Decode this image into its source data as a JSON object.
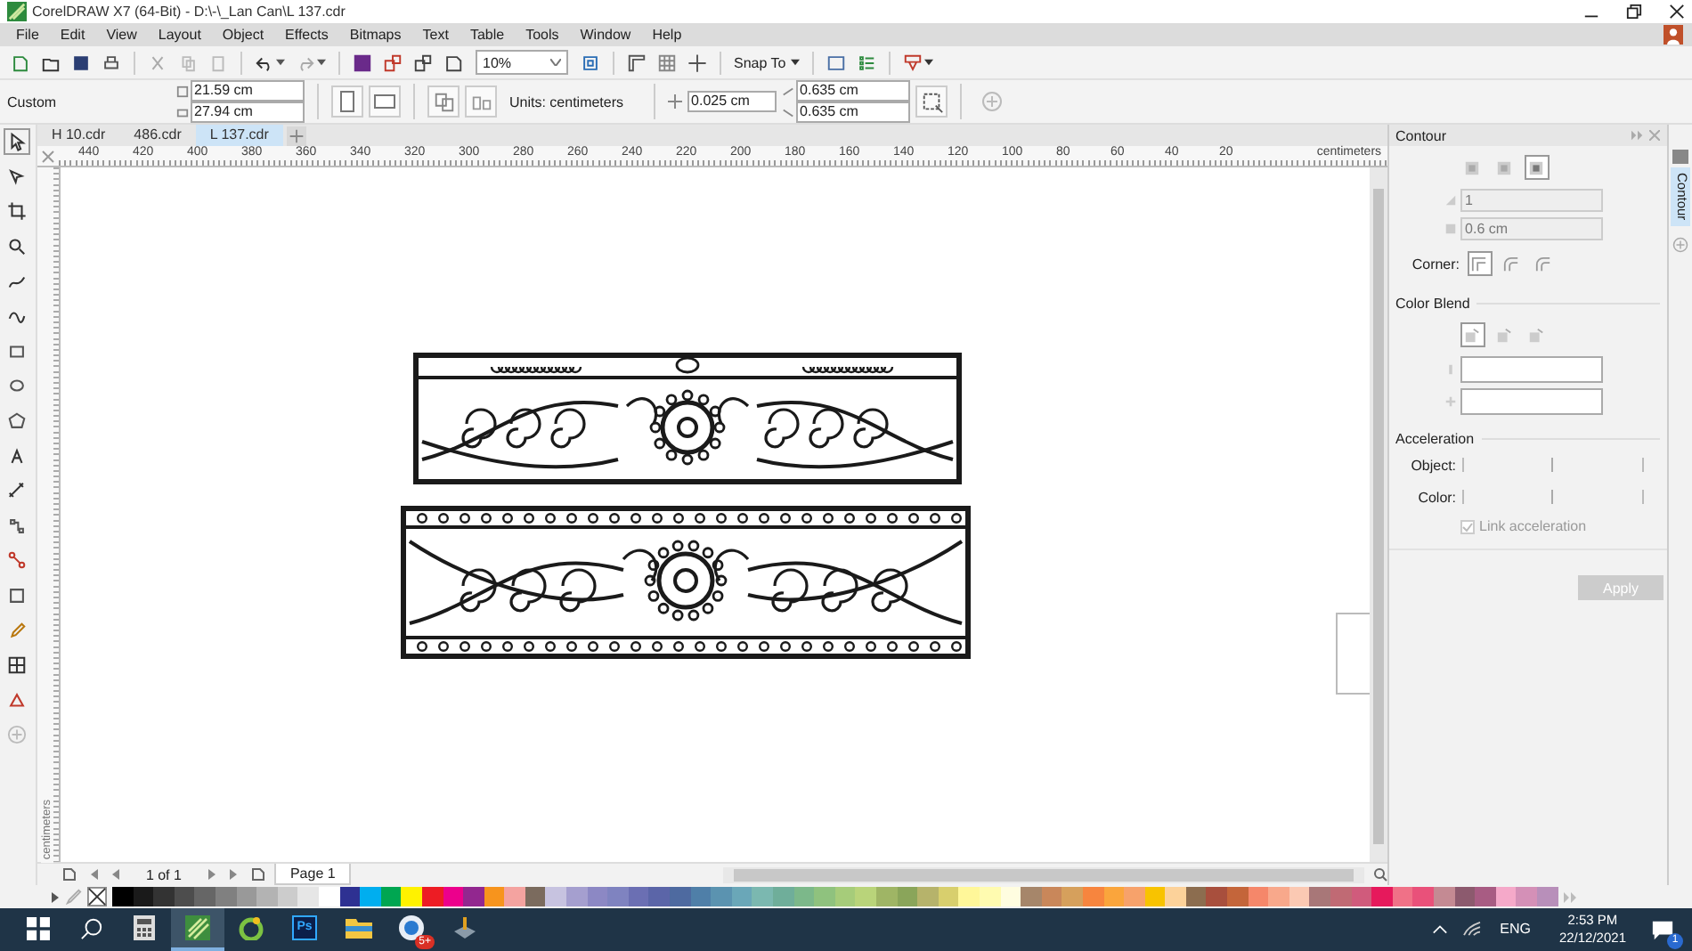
{
  "window": {
    "title": "CorelDRAW X7 (64-Bit) - D:\\-\\_Lan Can\\L 137.cdr"
  },
  "menu": [
    "File",
    "Edit",
    "View",
    "Layout",
    "Object",
    "Effects",
    "Bitmaps",
    "Text",
    "Table",
    "Tools",
    "Window",
    "Help"
  ],
  "toolbar": {
    "zoom": "10%",
    "snap": "Snap To"
  },
  "property_bar": {
    "preset": "Custom",
    "width": "21.59 cm",
    "height": "27.94 cm",
    "units": "Units: centimeters",
    "nudge": "0.025 cm",
    "duplicate_x": "0.635 cm",
    "duplicate_y": "0.635 cm"
  },
  "document_tabs": [
    {
      "label": "H 10.cdr",
      "selected": false
    },
    {
      "label": "486.cdr",
      "selected": false
    },
    {
      "label": "L 137.cdr",
      "selected": true
    }
  ],
  "ruler": {
    "labels": [
      "440",
      "420",
      "400",
      "380",
      "360",
      "340",
      "320",
      "300",
      "280",
      "260",
      "240",
      "220",
      "200",
      "180",
      "160",
      "140",
      "120",
      "100",
      "80",
      "60",
      "40",
      "20"
    ],
    "unit": "centimeters",
    "vertical_unit": "centimeters"
  },
  "docker": {
    "title": "Contour",
    "modes": [
      {
        "selected": false
      },
      {
        "selected": false
      },
      {
        "selected": true
      }
    ],
    "steps": {
      "value": "1",
      "disabled": true
    },
    "offset": {
      "value": "0.6 cm",
      "disabled": true
    },
    "corner_label": "Corner:",
    "corners": [
      {
        "selected": true
      },
      {
        "selected": false
      },
      {
        "selected": false
      }
    ],
    "color_blend_title": "Color Blend",
    "blends": [
      {
        "selected": true
      },
      {
        "selected": false
      },
      {
        "selected": false
      }
    ],
    "acceleration_title": "Acceleration",
    "object_acceleration": {
      "label": "Object:",
      "level": 0.5
    },
    "color_acceleration": {
      "label": "Color:",
      "level": 0.5
    },
    "link_acceleration": {
      "label": "Link acceleration",
      "checked": true,
      "disabled": true
    },
    "apply": {
      "label": "Apply",
      "disabled": true
    }
  },
  "side_tabs": [
    {
      "label": "Contour",
      "selected": true
    }
  ],
  "page_nav": {
    "counter": "1 of 1",
    "pages": [
      {
        "label": "Page 1",
        "selected": true
      }
    ]
  },
  "palette": [
    {
      "color": "#000000"
    },
    {
      "color": "#1a1a1a"
    },
    {
      "color": "#333333"
    },
    {
      "color": "#4d4d4d"
    },
    {
      "color": "#666666"
    },
    {
      "color": "#808080"
    },
    {
      "color": "#999999"
    },
    {
      "color": "#b3b3b3"
    },
    {
      "color": "#cccccc"
    },
    {
      "color": "#e6e6e6"
    },
    {
      "color": "#ffffff"
    },
    {
      "color": "#2e3192"
    },
    {
      "color": "#00aeef"
    },
    {
      "color": "#00a651"
    },
    {
      "color": "#fff200"
    },
    {
      "color": "#ed1c24"
    },
    {
      "color": "#ec008c"
    },
    {
      "color": "#92278f"
    },
    {
      "color": "#f7941d"
    },
    {
      "color": "#f4a3a0"
    },
    {
      "color": "#7b6b5e"
    },
    {
      "color": "#c7c3e0"
    },
    {
      "color": "#a59fcf"
    },
    {
      "color": "#8c88c4"
    },
    {
      "color": "#7f83c0"
    },
    {
      "color": "#6b6fb3"
    },
    {
      "color": "#5b65a8"
    },
    {
      "color": "#4e6aa0"
    },
    {
      "color": "#4f7fa8"
    },
    {
      "color": "#5b93b0"
    },
    {
      "color": "#6aa7b8"
    },
    {
      "color": "#7bb8b0"
    },
    {
      "color": "#6fae9a"
    },
    {
      "color": "#7cb88a"
    },
    {
      "color": "#8fc27e"
    },
    {
      "color": "#a6cc7a"
    },
    {
      "color": "#b9d47a"
    },
    {
      "color": "#9fb565"
    },
    {
      "color": "#8aa55a"
    },
    {
      "color": "#b6b36b"
    },
    {
      "color": "#d8cf6d"
    },
    {
      "color": "#fff799"
    },
    {
      "color": "#fffbb0"
    },
    {
      "color": "#fffde0"
    },
    {
      "color": "#a6866a"
    },
    {
      "color": "#c9875a"
    },
    {
      "color": "#d6a05c"
    },
    {
      "color": "#f7853e"
    },
    {
      "color": "#faa53c"
    },
    {
      "color": "#f7a26b"
    },
    {
      "color": "#f8c300"
    },
    {
      "color": "#fcd29a"
    },
    {
      "color": "#8c6d4f"
    },
    {
      "color": "#a84f3d"
    },
    {
      "color": "#c4653a"
    },
    {
      "color": "#f5876a"
    },
    {
      "color": "#f8a88b"
    },
    {
      "color": "#fbc9b3"
    },
    {
      "color": "#a87778"
    },
    {
      "color": "#c06a74"
    },
    {
      "color": "#d05b7c"
    },
    {
      "color": "#e6195c"
    },
    {
      "color": "#f07187"
    },
    {
      "color": "#e9517a"
    },
    {
      "color": "#c48a93"
    },
    {
      "color": "#8c5a6e"
    },
    {
      "color": "#a85c83"
    },
    {
      "color": "#f5a9c9"
    },
    {
      "color": "#d490b7"
    },
    {
      "color": "#b88fba"
    }
  ],
  "taskbar": {
    "apps": [
      {
        "kind": "start",
        "active": false
      },
      {
        "kind": "search",
        "active": false
      },
      {
        "kind": "calculator",
        "active": false
      },
      {
        "kind": "corel",
        "active": true
      },
      {
        "kind": "green",
        "active": false
      },
      {
        "kind": "photoshop",
        "label": "Ps",
        "active": false
      },
      {
        "kind": "explorer",
        "active": false
      },
      {
        "kind": "chat",
        "badge": "5+",
        "active": false
      },
      {
        "kind": "tool",
        "active": false
      }
    ],
    "language": "ENG",
    "time": "2:53 PM",
    "date": "22/12/2021",
    "notifications": "1"
  }
}
